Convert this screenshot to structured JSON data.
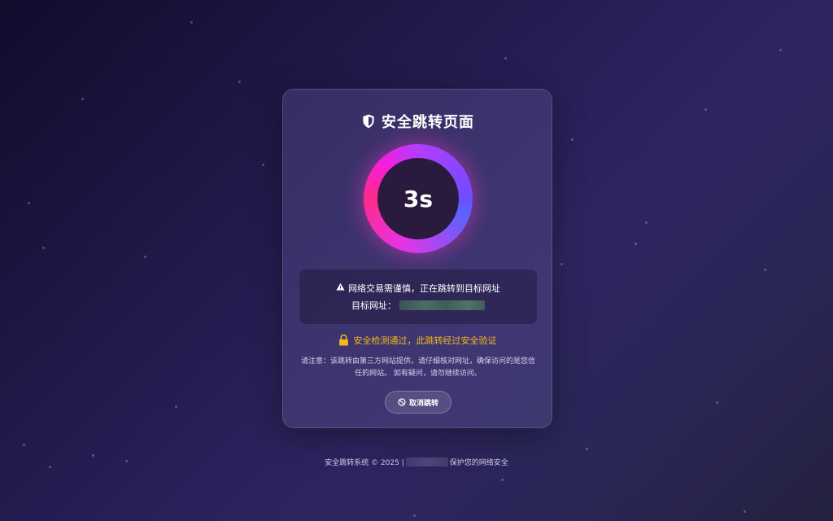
{
  "page": {
    "title": "安全跳转页面",
    "countdown": "3s",
    "notice": {
      "warning": "网络交易需谨慎，正在跳转到目标网址",
      "target_label": "目标网址："
    },
    "secure_text": "安全检测通过，此跳转经过安全验证",
    "note": "请注意：该跳转由第三方网站提供，请仔细核对网址，确保访问的是您信任的网站。 如有疑问，请勿继续访问。",
    "cancel_label": "取消跳转",
    "footer": {
      "left": "安全跳转系统 © 2025 |",
      "right": "保护您的网络安全"
    }
  },
  "colors": {
    "secure": "#f4b71c",
    "ring_pink": "#ff2a8a",
    "ring_blue": "#5a63ff",
    "card_bg": "#58508c"
  },
  "icons": {
    "title": "shield-icon",
    "warning": "warning-icon",
    "secure": "lock-icon",
    "cancel": "ban-icon"
  }
}
